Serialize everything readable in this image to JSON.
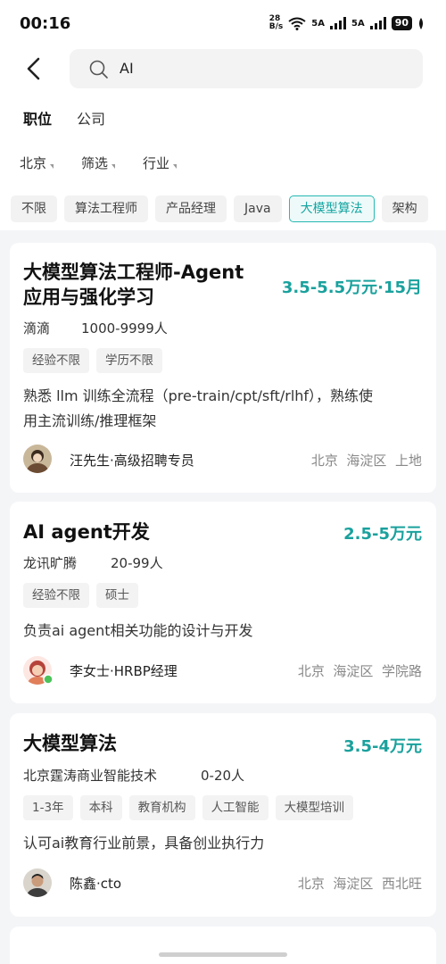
{
  "status": {
    "time": "00:16",
    "speed_top": "28",
    "speed_bottom": "B/s",
    "sim1": "5A",
    "sim2": "5A",
    "battery": "90"
  },
  "search": {
    "query": "AI"
  },
  "segments": [
    "职位",
    "公司"
  ],
  "filters": [
    "北京",
    "筛选",
    "行业"
  ],
  "chips": [
    "不限",
    "算法工程师",
    "产品经理",
    "Java",
    "大模型算法",
    "架构"
  ],
  "selected_chip": "大模型算法",
  "colors": {
    "accent": "#1aa19d",
    "chip_selected_bg": "#eefaf9"
  },
  "jobs": [
    {
      "title_line1": "大模型算法工程师-Agent",
      "title_line2": "应用与强化学习",
      "salary": "3.5-5.5万元·15月",
      "company": "滴滴",
      "size": "1000-9999人",
      "tags": [
        "经验不限",
        "学历不限"
      ],
      "desc_line1": "熟悉 llm 训练全流程（pre-train/cpt/sft/rlhf），熟练使",
      "desc_line2": "用主流训练/推理框架",
      "recruiter": "汪先生·高级招聘专员",
      "location": [
        "北京",
        "海淀区",
        "上地"
      ]
    },
    {
      "title_line1": "AI agent开发",
      "salary": "2.5-5万元",
      "company": "龙讯旷腾",
      "size": "20-99人",
      "tags": [
        "经验不限",
        "硕士"
      ],
      "desc_line1": "负责ai agent相关功能的设计与开发",
      "recruiter": "李女士·HRBP经理",
      "location": [
        "北京",
        "海淀区",
        "学院路"
      ]
    },
    {
      "title_line1": "大模型算法",
      "salary": "3.5-4万元",
      "company": "北京霆涛商业智能技术",
      "size": "0-20人",
      "tags": [
        "1-3年",
        "本科",
        "教育机构",
        "人工智能",
        "大模型培训"
      ],
      "desc_line1": "认可ai教育行业前景，具备创业执行力",
      "recruiter": "陈鑫·cto",
      "location": [
        "北京",
        "海淀区",
        "西北旺"
      ]
    }
  ]
}
